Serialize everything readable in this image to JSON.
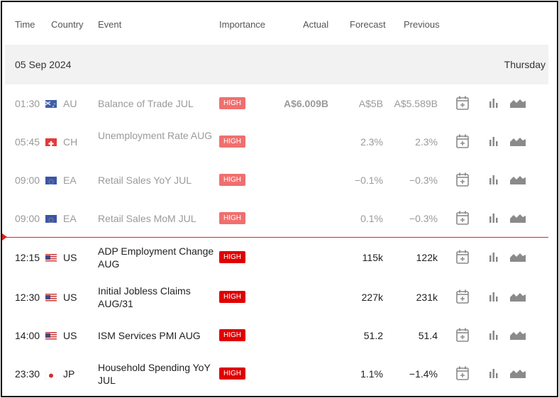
{
  "headers": {
    "time": "Time",
    "country": "Country",
    "event": "Event",
    "importance": "Importance",
    "actual": "Actual",
    "forecast": "Forecast",
    "previous": "Previous"
  },
  "date_header": {
    "date": "05 Sep 2024",
    "day": "Thursday"
  },
  "colors": {
    "high_past": "#ef6f6f",
    "high_upcoming": "#e00000",
    "now_line": "#e02020"
  },
  "rows": [
    {
      "time": "01:30",
      "country": "AU",
      "flag": "australia-flag-icon",
      "event": "Balance of Trade JUL",
      "importance": "HIGH",
      "actual": "A$6.009B",
      "forecast": "A$5B",
      "previous": "A$5.589B"
    },
    {
      "time": "05:45",
      "country": "CH",
      "flag": "switzerland-flag-icon",
      "event": "Unemployment Rate AUG",
      "importance": "HIGH",
      "actual": "",
      "forecast": "2.3%",
      "previous": "2.3%"
    },
    {
      "time": "09:00",
      "country": "EA",
      "flag": "euro-area-flag-icon",
      "event": "Retail Sales YoY JUL",
      "importance": "HIGH",
      "actual": "",
      "forecast": "−0.1%",
      "previous": "−0.3%"
    },
    {
      "time": "09:00",
      "country": "EA",
      "flag": "euro-area-flag-icon",
      "event": "Retail Sales MoM JUL",
      "importance": "HIGH",
      "actual": "",
      "forecast": "0.1%",
      "previous": "−0.3%"
    },
    {
      "time": "12:15",
      "country": "US",
      "flag": "us-flag-icon",
      "event": "ADP Employment Change AUG",
      "importance": "HIGH",
      "actual": "",
      "forecast": "115k",
      "previous": "122k"
    },
    {
      "time": "12:30",
      "country": "US",
      "flag": "us-flag-icon",
      "event": "Initial Jobless Claims AUG/31",
      "importance": "HIGH",
      "actual": "",
      "forecast": "227k",
      "previous": "231k"
    },
    {
      "time": "14:00",
      "country": "US",
      "flag": "us-flag-icon",
      "event": "ISM Services PMI AUG",
      "importance": "HIGH",
      "actual": "",
      "forecast": "51.2",
      "previous": "51.4"
    },
    {
      "time": "23:30",
      "country": "JP",
      "flag": "japan-flag-icon",
      "event": "Household Spending YoY JUL",
      "importance": "HIGH",
      "actual": "",
      "forecast": "1.1%",
      "previous": "−1.4%"
    }
  ],
  "row_actions": [
    "add-to-calendar-icon",
    "bar-chart-icon",
    "area-chart-icon"
  ]
}
